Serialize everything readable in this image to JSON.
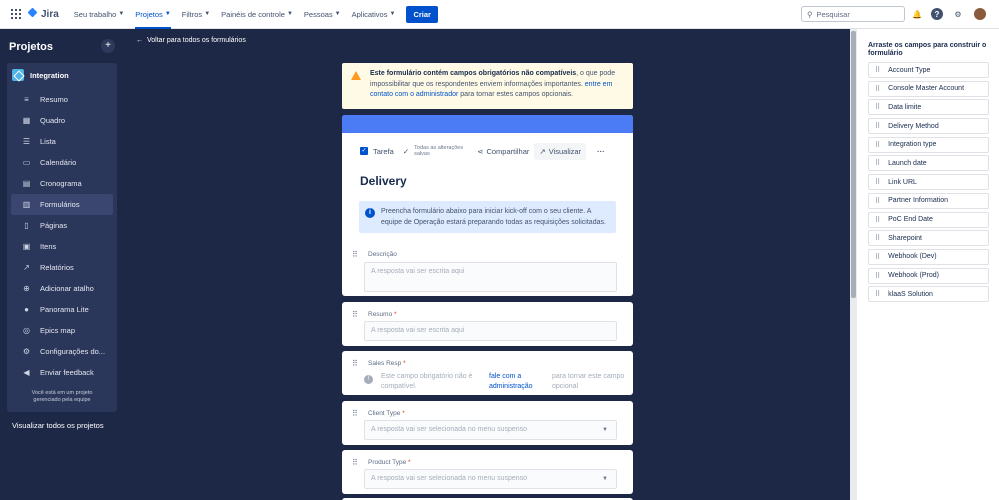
{
  "topbar": {
    "logo": "Jira",
    "nav": [
      {
        "label": "Seu trabalho",
        "active": false
      },
      {
        "label": "Projetos",
        "active": true
      },
      {
        "label": "Filtros",
        "active": false
      },
      {
        "label": "Painéis de controle",
        "active": false
      },
      {
        "label": "Pessoas",
        "active": false
      },
      {
        "label": "Aplicativos",
        "active": false
      }
    ],
    "create_label": "Criar",
    "search_placeholder": "Pesquisar"
  },
  "sidebar": {
    "title": "Projetos",
    "project_name": "Integration",
    "items": [
      {
        "label": "Resumo",
        "icon": "summary-icon"
      },
      {
        "label": "Quadro",
        "icon": "board-icon"
      },
      {
        "label": "Lista",
        "icon": "list-icon"
      },
      {
        "label": "Calendário",
        "icon": "calendar-icon"
      },
      {
        "label": "Cronograma",
        "icon": "timeline-icon"
      },
      {
        "label": "Formulários",
        "icon": "forms-icon",
        "active": true
      },
      {
        "label": "Páginas",
        "icon": "pages-icon"
      },
      {
        "label": "Itens",
        "icon": "issues-icon"
      },
      {
        "label": "Relatórios",
        "icon": "reports-icon"
      },
      {
        "label": "Adicionar atalho",
        "icon": "add-shortcut-icon"
      },
      {
        "label": "Panorama Lite",
        "icon": "panorama-icon"
      },
      {
        "label": "Epics map",
        "icon": "epics-map-icon"
      },
      {
        "label": "Configurações do...",
        "icon": "settings-icon"
      },
      {
        "label": "Enviar feedback",
        "icon": "feedback-icon"
      }
    ],
    "team_note_1": "Você está em um projeto",
    "team_note_2": "gerenciado pela equipe",
    "view_all": "Visualizar todos os projetos"
  },
  "main": {
    "back_label": "Voltar para todos os formulários",
    "warning": {
      "bold": "Este formulário contém campos obrigatórios não compatíveis",
      "text1": ", o que pode impossibilitar que os respondentes enviem informações importantes.",
      "link": "entre em contato com o administrador",
      "text2": "para tornar estes campos opcionais."
    },
    "toolbar": {
      "type_label": "Tarefa",
      "saved_label": "Todas as alterações salvas",
      "share_label": "Compartilhar",
      "view_label": "Visualizar"
    },
    "form_title": "Delivery",
    "info_text": "Preencha formulário abaixo para iniciar kick-off com o seu cliente. A equipe de Operação estará preparando todas as requisições solicitadas.",
    "fields": [
      {
        "label": "Descrição",
        "required": "",
        "placeholder": "A resposta vai ser escrita aqui"
      },
      {
        "label": "Resumo",
        "required": "*",
        "placeholder": "A resposta vai ser escrita aqui"
      },
      {
        "label": "Sales Resp",
        "required": "*",
        "unsupported_1": "Este campo obrigatório não é compatível.",
        "unsupported_link": "fale com a administração",
        "unsupported_2": "para tornar este campo opcional"
      },
      {
        "label": "Client Type",
        "required": "*",
        "placeholder": "A resposta vai ser selecionada no menu suspenso"
      },
      {
        "label": "Product Type",
        "required": "*",
        "placeholder": "A resposta vai ser selecionada no menu suspenso"
      }
    ]
  },
  "right_panel": {
    "title": "Arraste os campos para construir o formulário",
    "fields": [
      "Account Type",
      "Console Master Account",
      "Data limite",
      "Delivery Method",
      "Integration type",
      "Launch date",
      "Link URL",
      "Partner Information",
      "PoC End Date",
      "Sharepoint",
      "Webhook (Dev)",
      "Webhook (Prod)",
      "klaaS Solution"
    ]
  }
}
